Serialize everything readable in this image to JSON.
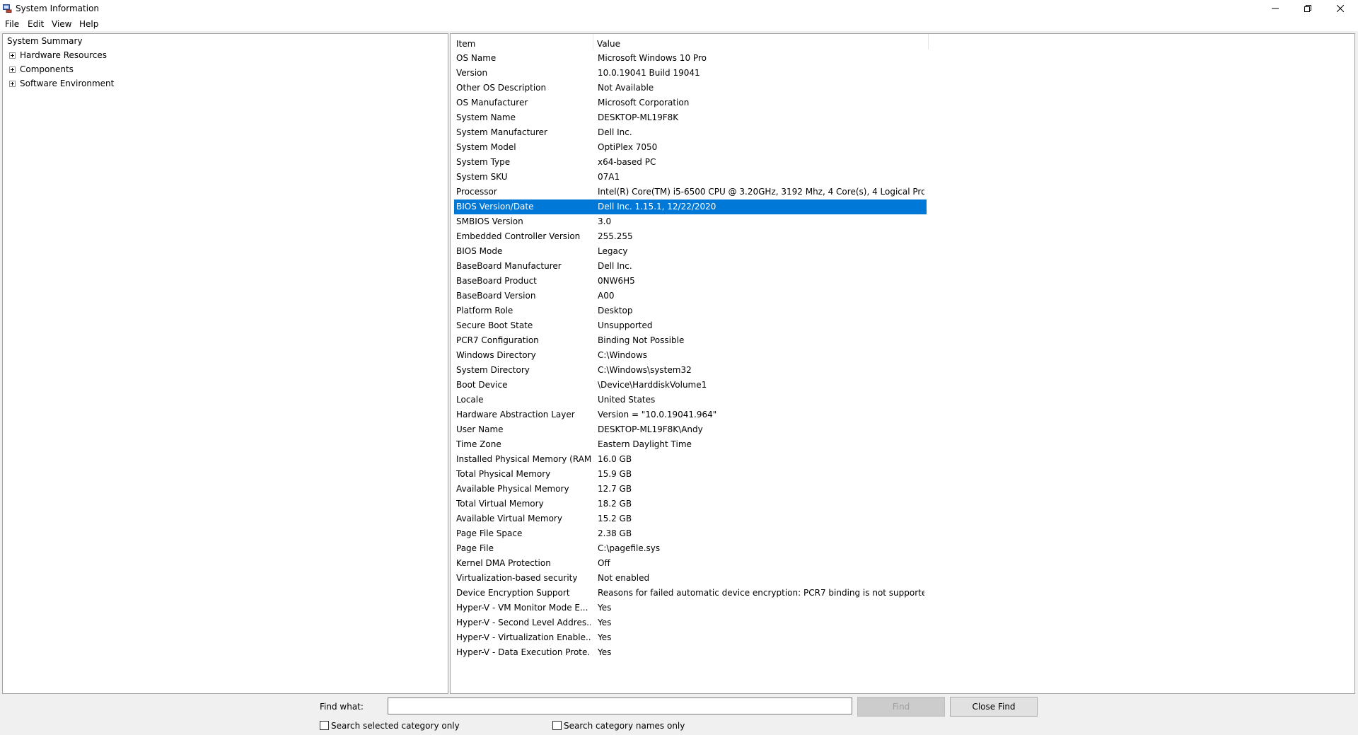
{
  "window": {
    "title": "System Information",
    "icon": "system-information-icon",
    "controls": [
      "minimize-icon",
      "restore-icon",
      "close-icon"
    ]
  },
  "menu": [
    "File",
    "Edit",
    "View",
    "Help"
  ],
  "tree": {
    "root": "System Summary",
    "children": [
      "Hardware Resources",
      "Components",
      "Software Environment"
    ]
  },
  "table": {
    "columns": [
      "Item",
      "Value"
    ],
    "selected_index": 10,
    "rows": [
      {
        "item": "OS Name",
        "value": "Microsoft Windows 10 Pro"
      },
      {
        "item": "Version",
        "value": "10.0.19041 Build 19041"
      },
      {
        "item": "Other OS Description",
        "value": "Not Available"
      },
      {
        "item": "OS Manufacturer",
        "value": "Microsoft Corporation"
      },
      {
        "item": "System Name",
        "value": "DESKTOP-ML19F8K"
      },
      {
        "item": "System Manufacturer",
        "value": "Dell Inc."
      },
      {
        "item": "System Model",
        "value": "OptiPlex 7050"
      },
      {
        "item": "System Type",
        "value": "x64-based PC"
      },
      {
        "item": "System SKU",
        "value": "07A1"
      },
      {
        "item": "Processor",
        "value": "Intel(R) Core(TM) i5-6500 CPU @ 3.20GHz, 3192 Mhz, 4 Core(s), 4 Logical Pro..."
      },
      {
        "item": "BIOS Version/Date",
        "value": "Dell Inc. 1.15.1, 12/22/2020"
      },
      {
        "item": "SMBIOS Version",
        "value": "3.0"
      },
      {
        "item": "Embedded Controller Version",
        "value": "255.255"
      },
      {
        "item": "BIOS Mode",
        "value": "Legacy"
      },
      {
        "item": "BaseBoard Manufacturer",
        "value": "Dell Inc."
      },
      {
        "item": "BaseBoard Product",
        "value": "0NW6H5"
      },
      {
        "item": "BaseBoard Version",
        "value": "A00"
      },
      {
        "item": "Platform Role",
        "value": "Desktop"
      },
      {
        "item": "Secure Boot State",
        "value": "Unsupported"
      },
      {
        "item": "PCR7 Configuration",
        "value": "Binding Not Possible"
      },
      {
        "item": "Windows Directory",
        "value": "C:\\Windows"
      },
      {
        "item": "System Directory",
        "value": "C:\\Windows\\system32"
      },
      {
        "item": "Boot Device",
        "value": "\\Device\\HarddiskVolume1"
      },
      {
        "item": "Locale",
        "value": "United States"
      },
      {
        "item": "Hardware Abstraction Layer",
        "value": "Version = \"10.0.19041.964\""
      },
      {
        "item": "User Name",
        "value": "DESKTOP-ML19F8K\\Andy"
      },
      {
        "item": "Time Zone",
        "value": "Eastern Daylight Time"
      },
      {
        "item": "Installed Physical Memory (RAM)",
        "value": "16.0 GB"
      },
      {
        "item": "Total Physical Memory",
        "value": "15.9 GB"
      },
      {
        "item": "Available Physical Memory",
        "value": "12.7 GB"
      },
      {
        "item": "Total Virtual Memory",
        "value": "18.2 GB"
      },
      {
        "item": "Available Virtual Memory",
        "value": "15.2 GB"
      },
      {
        "item": "Page File Space",
        "value": "2.38 GB"
      },
      {
        "item": "Page File",
        "value": "C:\\pagefile.sys"
      },
      {
        "item": "Kernel DMA Protection",
        "value": "Off"
      },
      {
        "item": "Virtualization-based security",
        "value": "Not enabled"
      },
      {
        "item": "Device Encryption Support",
        "value": "Reasons for failed automatic device encryption: PCR7 binding is not supporte..."
      },
      {
        "item": "Hyper-V - VM Monitor Mode E...",
        "value": "Yes"
      },
      {
        "item": "Hyper-V - Second Level Addres...",
        "value": "Yes"
      },
      {
        "item": "Hyper-V - Virtualization Enable...",
        "value": "Yes"
      },
      {
        "item": "Hyper-V - Data Execution Prote...",
        "value": "Yes"
      }
    ]
  },
  "find": {
    "label": "Find what:",
    "value": "",
    "find_button": "Find",
    "close_button": "Close Find",
    "option1": "Search selected category only",
    "option2": "Search category names only"
  },
  "colors": {
    "selection": "#0078d7"
  }
}
